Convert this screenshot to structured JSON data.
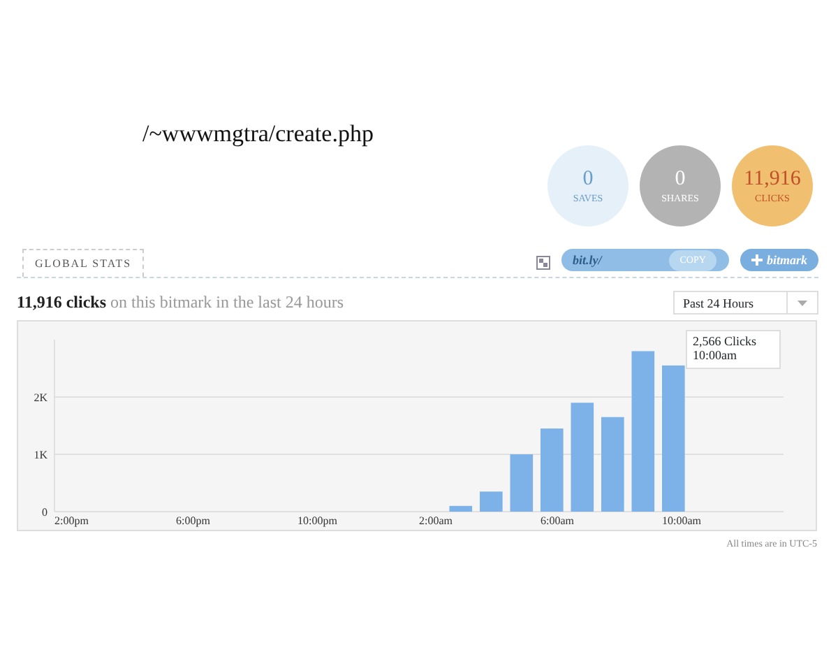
{
  "page_title": "/~wwwmgtra/create.php",
  "stats": [
    {
      "value": "0",
      "label": "SAVES",
      "color": "#e6f0f8"
    },
    {
      "value": "0",
      "label": "SHARES",
      "color": "#b3b3b3"
    },
    {
      "value": "11,916",
      "label": "CLICKS",
      "color": "#f0c070"
    }
  ],
  "tabs": [
    {
      "label": "GLOBAL STATS",
      "selected": true
    }
  ],
  "short_link": {
    "text": "bit.ly/",
    "copy_button": "COPY"
  },
  "bitmark_button": "bitmark",
  "summary": {
    "count": "11,916 clicks",
    "rest": "on this bitmark in the last 24 hours"
  },
  "period_select": {
    "value": "Past 24 Hours"
  },
  "chart": {
    "chart_data": {
      "type": "bar",
      "categories": [
        "2:00pm",
        null,
        null,
        null,
        "6:00pm",
        null,
        null,
        null,
        "10:00pm",
        null,
        null,
        null,
        "2:00am",
        null,
        null,
        null,
        "6:00am",
        null,
        null,
        null,
        "10:00am",
        null,
        null,
        null
      ],
      "series": [
        {
          "color": "#7cb2e8",
          "values": [
            null,
            null,
            null,
            null,
            null,
            null,
            null,
            null,
            null,
            null,
            null,
            null,
            null,
            100,
            350,
            1000,
            1450,
            1900,
            1650,
            2800,
            2550,
            null,
            null,
            null
          ]
        }
      ],
      "ylim": [
        0,
        3000
      ],
      "yticks": [
        {
          "value": 0,
          "label": "0"
        },
        {
          "value": 1000,
          "label": "1K"
        },
        {
          "value": 2000,
          "label": "2K"
        }
      ]
    },
    "tooltip": {
      "clicks": "2,566 Clicks",
      "time": "10:00am"
    }
  },
  "footnote": "All times are in UTC-5"
}
